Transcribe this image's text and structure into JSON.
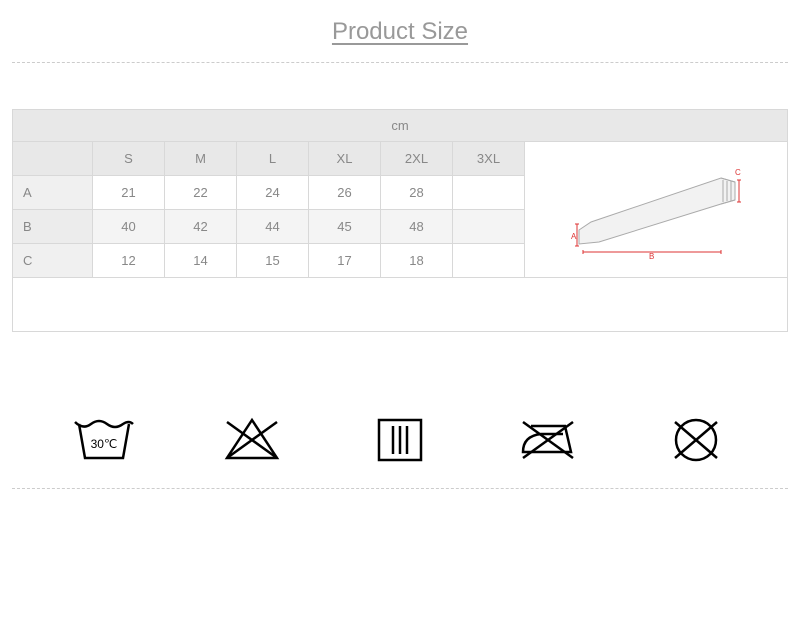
{
  "title": "Product Size",
  "chart_data": {
    "type": "table",
    "title": "Product Size",
    "unit": "cm",
    "sizes": [
      "S",
      "M",
      "L",
      "XL",
      "2XL",
      "3XL"
    ],
    "measurements": [
      {
        "label": "A",
        "values": [
          "21",
          "22",
          "24",
          "26",
          "28",
          ""
        ]
      },
      {
        "label": "B",
        "values": [
          "40",
          "42",
          "44",
          "45",
          "48",
          ""
        ]
      },
      {
        "label": "C",
        "values": [
          "12",
          "14",
          "15",
          "17",
          "18",
          ""
        ]
      }
    ],
    "diagram_labels": [
      "A",
      "B",
      "C"
    ]
  },
  "care_icons": [
    {
      "name": "wash-30",
      "label": "30℃"
    },
    {
      "name": "do-not-bleach"
    },
    {
      "name": "tumble-dry"
    },
    {
      "name": "do-not-iron"
    },
    {
      "name": "do-not-dry-clean"
    }
  ]
}
